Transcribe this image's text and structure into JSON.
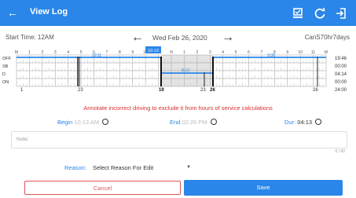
{
  "appbar": {
    "title": "View Log"
  },
  "header": {
    "start_time": "Start Time: 12AM",
    "date": "Wed Feb 26, 2020",
    "carrier": "CanS70hr7days"
  },
  "graph": {
    "rows": [
      "OFF",
      "SB",
      "D",
      "ON"
    ],
    "hour_labels": [
      "M",
      "1",
      "2",
      "3",
      "4",
      "5",
      "6",
      "7",
      "8",
      "9",
      "10",
      "11",
      "N",
      "1",
      "2",
      "3",
      "4",
      "5",
      "6",
      "7",
      "8",
      "9",
      "10",
      "11",
      "M"
    ],
    "selection_label": "10:13",
    "segment_labels": [
      "10:11",
      "8:13",
      "9:38"
    ],
    "totals": [
      "19:46",
      "00:00",
      "04:14",
      "00:00",
      "24:00"
    ],
    "bottom_labels": [
      "1",
      "23",
      "19",
      "23",
      "26",
      "26"
    ]
  },
  "warning": "Annotate incorrect driving to exclude it from hours of service calculations",
  "times": {
    "begin_label": "Begin",
    "begin_value": "10:13 AM",
    "end_label": "End",
    "end_value": "02:26 PM",
    "dur_label": "Dur:",
    "dur_value": "04:13"
  },
  "note": {
    "placeholder": "Note:",
    "counter": "0 / 60"
  },
  "reason": {
    "label": "Reason:",
    "value": "Select Reason For Edit"
  },
  "buttons": {
    "cancel": "Cancel",
    "save": "Save"
  },
  "colors": {
    "accent": "#2a86e8",
    "warning": "#d32f2f"
  }
}
